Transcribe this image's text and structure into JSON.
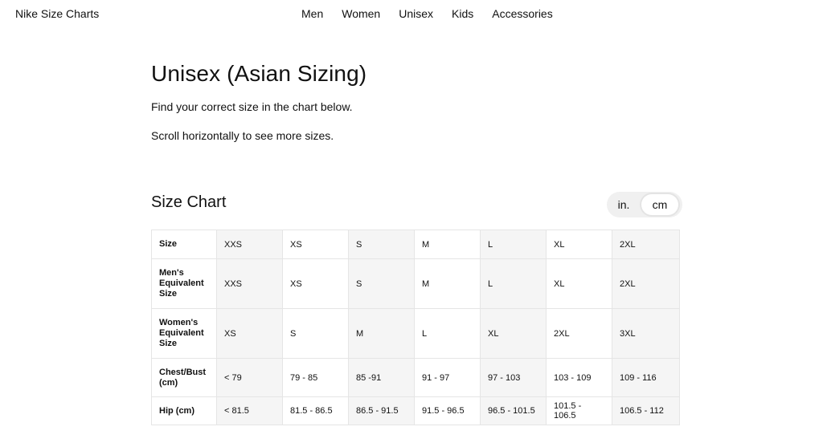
{
  "brand": "Nike Size Charts",
  "nav": [
    "Men",
    "Women",
    "Unisex",
    "Kids",
    "Accessories"
  ],
  "page": {
    "title": "Unisex (Asian Sizing)",
    "intro": "Find your correct size in the chart below.",
    "scroll_hint": "Scroll horizontally to see more sizes."
  },
  "chart": {
    "title": "Size Chart",
    "units": {
      "inch": "in.",
      "cm": "cm",
      "selected": "cm"
    }
  },
  "table": {
    "rows": [
      {
        "label": "Size",
        "cells": [
          "XXS",
          "XS",
          "S",
          "M",
          "L",
          "XL",
          "2XL"
        ]
      },
      {
        "label": "Men's Equivalent Size",
        "cells": [
          "XXS",
          "XS",
          "S",
          "M",
          "L",
          "XL",
          "2XL"
        ]
      },
      {
        "label": "Women's Equivalent Size",
        "cells": [
          "XS",
          "S",
          "M",
          "L",
          "XL",
          "2XL",
          "3XL"
        ]
      },
      {
        "label": "Chest/Bust (cm)",
        "cells": [
          "< 79",
          "79 - 85",
          "85 -91",
          "91 - 97",
          "97 - 103",
          "103 - 109",
          "109 - 116"
        ]
      },
      {
        "label": "Hip (cm)",
        "cells": [
          "< 81.5",
          "81.5 - 86.5",
          "86.5 - 91.5",
          "91.5 - 96.5",
          "96.5 - 101.5",
          "101.5 - 106.5",
          "106.5 - 112"
        ]
      }
    ]
  },
  "colors": {
    "alt_column_bg": "#f5f5f5",
    "toggle_bg": "#f0f0f0",
    "text": "#111111"
  }
}
